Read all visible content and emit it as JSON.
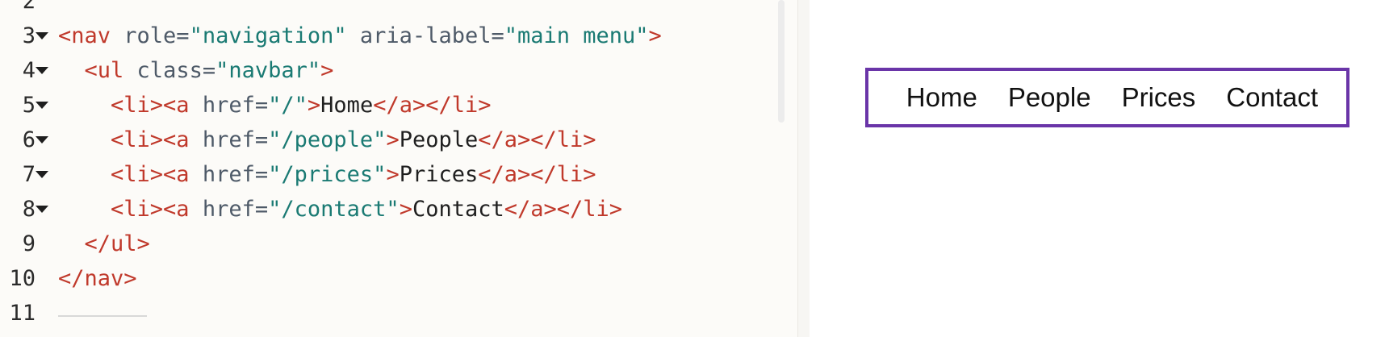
{
  "editor": {
    "lines": [
      {
        "num": "2",
        "fold": false,
        "tokens": []
      },
      {
        "num": "3",
        "fold": true,
        "tokens": [
          {
            "t": "tag",
            "v": "<nav"
          },
          {
            "t": "attr",
            "v": " role="
          },
          {
            "t": "str",
            "v": "\"navigation\""
          },
          {
            "t": "attr",
            "v": " aria-label="
          },
          {
            "t": "str",
            "v": "\"main menu\""
          },
          {
            "t": "tag",
            "v": ">"
          }
        ]
      },
      {
        "num": "4",
        "fold": true,
        "tokens": [
          {
            "t": "txt",
            "v": "  "
          },
          {
            "t": "tag",
            "v": "<ul"
          },
          {
            "t": "attr",
            "v": " class="
          },
          {
            "t": "str",
            "v": "\"navbar\""
          },
          {
            "t": "tag",
            "v": ">"
          }
        ]
      },
      {
        "num": "5",
        "fold": true,
        "tokens": [
          {
            "t": "txt",
            "v": "    "
          },
          {
            "t": "tag",
            "v": "<li><a"
          },
          {
            "t": "attr",
            "v": " href="
          },
          {
            "t": "str",
            "v": "\"/\""
          },
          {
            "t": "tag",
            "v": ">"
          },
          {
            "t": "txt",
            "v": "Home"
          },
          {
            "t": "tag",
            "v": "</a></li>"
          }
        ]
      },
      {
        "num": "6",
        "fold": true,
        "tokens": [
          {
            "t": "txt",
            "v": "    "
          },
          {
            "t": "tag",
            "v": "<li><a"
          },
          {
            "t": "attr",
            "v": " href="
          },
          {
            "t": "str",
            "v": "\"/people\""
          },
          {
            "t": "tag",
            "v": ">"
          },
          {
            "t": "txt",
            "v": "People"
          },
          {
            "t": "tag",
            "v": "</a></li>"
          }
        ]
      },
      {
        "num": "7",
        "fold": true,
        "tokens": [
          {
            "t": "txt",
            "v": "    "
          },
          {
            "t": "tag",
            "v": "<li><a"
          },
          {
            "t": "attr",
            "v": " href="
          },
          {
            "t": "str",
            "v": "\"/prices\""
          },
          {
            "t": "tag",
            "v": ">"
          },
          {
            "t": "txt",
            "v": "Prices"
          },
          {
            "t": "tag",
            "v": "</a></li>"
          }
        ]
      },
      {
        "num": "8",
        "fold": true,
        "tokens": [
          {
            "t": "txt",
            "v": "    "
          },
          {
            "t": "tag",
            "v": "<li><a"
          },
          {
            "t": "attr",
            "v": " href="
          },
          {
            "t": "str",
            "v": "\"/contact\""
          },
          {
            "t": "tag",
            "v": ">"
          },
          {
            "t": "txt",
            "v": "Contact"
          },
          {
            "t": "tag",
            "v": "</a></li>"
          }
        ]
      },
      {
        "num": "9",
        "fold": false,
        "tokens": [
          {
            "t": "txt",
            "v": "  "
          },
          {
            "t": "tag",
            "v": "</ul>"
          }
        ]
      },
      {
        "num": "10",
        "fold": false,
        "tokens": [
          {
            "t": "tag",
            "v": "</nav>"
          }
        ]
      },
      {
        "num": "11",
        "fold": false,
        "tokens": []
      }
    ]
  },
  "preview": {
    "nav_items": [
      "Home",
      "People",
      "Prices",
      "Contact"
    ],
    "border_color": "#6a35a8"
  }
}
